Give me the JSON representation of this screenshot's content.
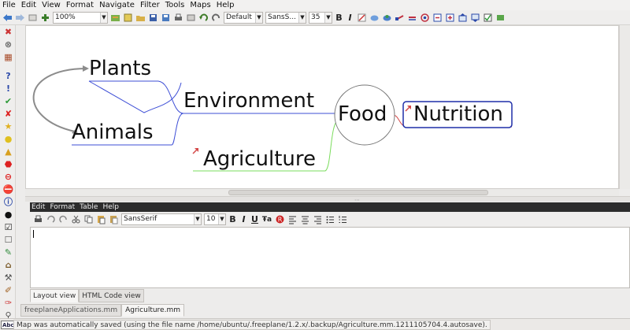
{
  "menubar": {
    "items": [
      "File",
      "Edit",
      "View",
      "Format",
      "Navigate",
      "Filter",
      "Tools",
      "Maps",
      "Help"
    ]
  },
  "toolbar": {
    "zoom_value": "100%",
    "style_value": "Default",
    "font_value": "SansS...",
    "size_value": "35",
    "bold_label": "B",
    "italic_label": "I"
  },
  "map": {
    "nodes": {
      "plants": "Plants",
      "animals": "Animals",
      "environment": "Environment",
      "food": "Food",
      "nutrition": "Nutrition",
      "agriculture": "Agriculture"
    },
    "colors": {
      "blue_edge": "#3e4fd6",
      "green_edge": "#7adc5c",
      "red_edge": "#d44a4a",
      "arrow": "#8c8c8c",
      "nutrition_border": "#1f2fa8"
    }
  },
  "editor": {
    "menu": [
      "Edit",
      "Format",
      "Table",
      "Help"
    ],
    "font_value": "SansSerif",
    "size_value": "10",
    "bold": "B",
    "italic": "I",
    "underline": "U",
    "strike": "Ŧa",
    "content": ""
  },
  "view_tabs": [
    "Layout view",
    "HTML Code view"
  ],
  "map_tabs": [
    "freeplaneApplications.mm",
    "Agriculture.mm"
  ],
  "status": {
    "abc_badge": "Abc",
    "message": "Map was automatically saved (using the file name /home/ubuntu/.freeplane/1.2.x/.backup/Agriculture.mm.1211105704.4.autosave)."
  }
}
